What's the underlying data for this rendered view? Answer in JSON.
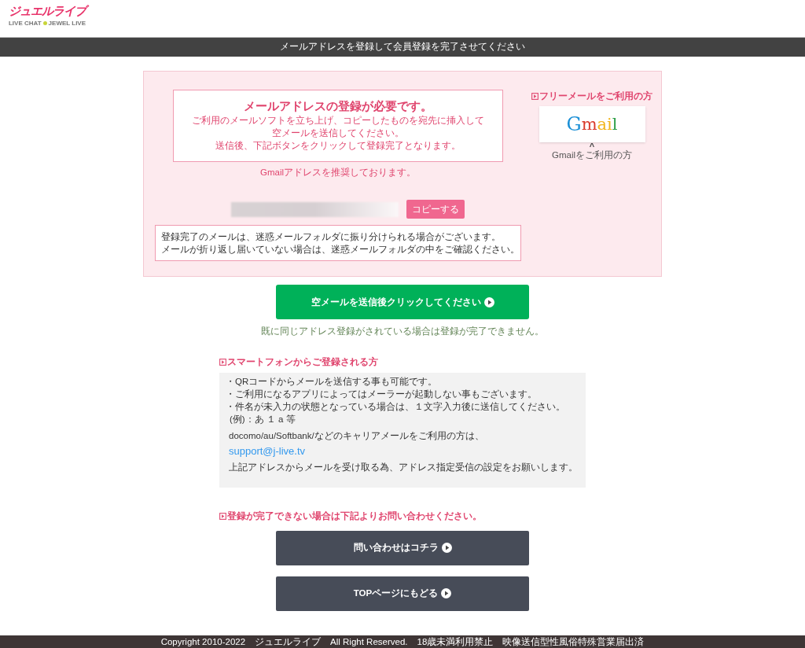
{
  "logo": {
    "title": "ジュエルライブ",
    "subtitle_left": "LIVE CHAT",
    "subtitle_right": "JEWEL LIVE"
  },
  "banner": "メールアドレスを登録して会員登録を完了させてください",
  "notice": {
    "title": "メールアドレスの登録が必要です。",
    "lines": [
      "ご利用のメールソフトを立ち上げ、コピーしたものを宛先に挿入して",
      "空メールを送信してください。",
      "送信後、下記ボタンをクリックして登録完了となります。"
    ]
  },
  "recommend": "Gmailアドレスを推奨しております。",
  "copy_button": "コピーする",
  "spam_note": [
    "登録完了のメールは、迷惑メールフォルダに振り分けられる場合がございます。",
    "メールが折り返し届いていない場合は、迷惑メールフォルダの中をご確認ください。"
  ],
  "free_mail": {
    "heading": "フリーメールをご利用の方",
    "logo_text": "Gmail",
    "caret": "^",
    "caption": "Gmailをご利用の方"
  },
  "send_button": "空メールを送信後クリックしてください",
  "duplicate_note": "既に同じアドレス登録がされている場合は登録が完了できません。",
  "smartphone": {
    "heading": "スマートフォンからご登録される方",
    "bullets": [
      "・QRコードからメールを送信する事も可能です。",
      "・ご利用になるアプリによってはメーラーが起動しない事もございます。",
      "・件名が未入力の状態となっている場合は、１文字入力後に送信してください。"
    ],
    "example": "(例)：あ １ a 等",
    "carrier": "docomo/au/Softbank/などのキャリアメールをご利用の方は、",
    "address": "support@j-live.tv",
    "setting": "上記アドレスからメールを受け取る為、アドレス指定受信の設定をお願いします。"
  },
  "contact_heading": "登録が完了できない場合は下記よりお問い合わせください。",
  "buttons": [
    "問い合わせはコチラ",
    "TOPページにもどる"
  ],
  "footer": "Copyright 2010-2022　ジュエルライブ　All Right Reserved.　18歳未満利用禁止　映像送信型性風俗特殊営業届出済"
}
